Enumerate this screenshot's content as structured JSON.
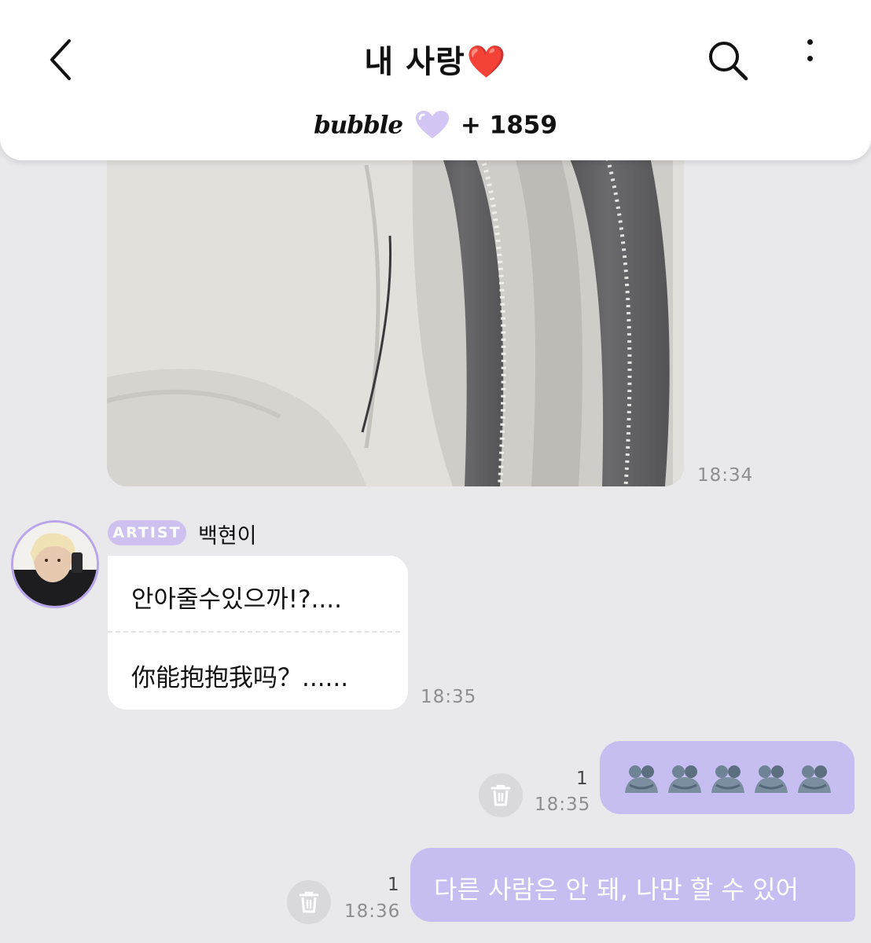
{
  "header": {
    "title": "내 사랑",
    "title_emoji": "❤️",
    "bubble_logo": "bubble",
    "bubble_count": "+ 1859"
  },
  "messages": {
    "photo_time": "18:34",
    "artist": {
      "badge": "ARTIST",
      "name": "백현이",
      "line1": "안아줄수있으까!?....",
      "line2": "你能抱抱我吗？......",
      "time": "18:35"
    },
    "reply1": {
      "read_count": "1",
      "time": "18:35",
      "content": "hug emoji ×5"
    },
    "reply2": {
      "read_count": "1",
      "time": "18:36",
      "text": "다른 사람은 안 돼, 나만 할 수 있어"
    }
  },
  "colors": {
    "background": "#e9e9eb",
    "my_bubble": "#c6bdf0",
    "artist_badge": "#cfc1ef",
    "heart_red": "#e2262d"
  },
  "icons": [
    "back-chevron-icon",
    "search-icon",
    "more-vertical-icon",
    "bubble-heart-icon",
    "trash-icon",
    "hug-emoji-icon"
  ]
}
